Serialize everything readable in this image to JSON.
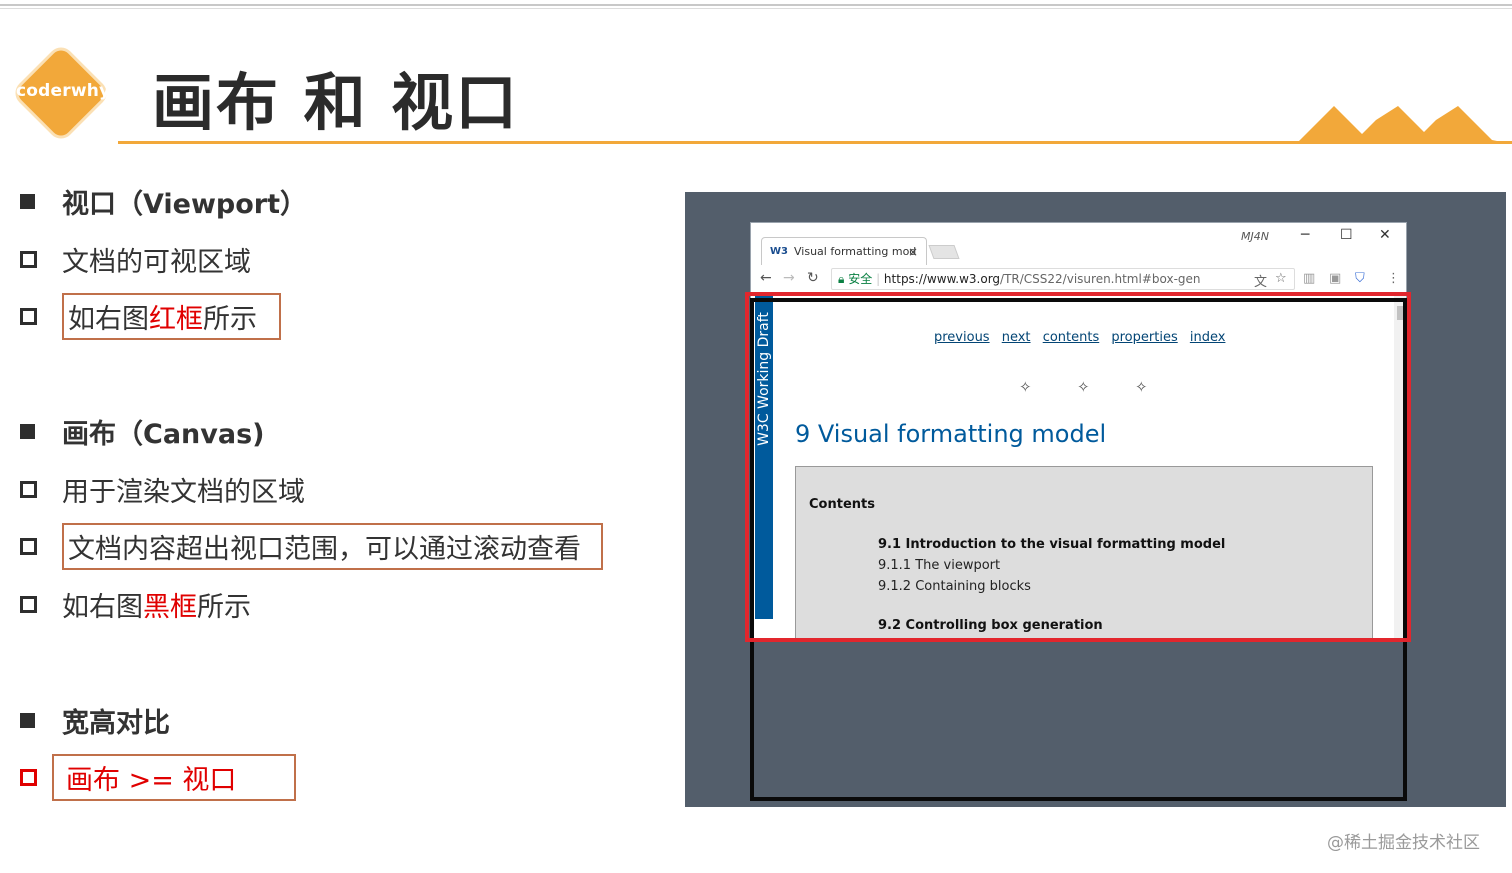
{
  "logo": {
    "text": "coderwhy"
  },
  "title": "画布 和 视口",
  "sections": [
    {
      "heading": "视口（Viewport）",
      "items": [
        {
          "segments": [
            "文档的可视区域"
          ]
        },
        {
          "segments": [
            "如右图",
            "红框",
            "所示"
          ]
        }
      ]
    },
    {
      "heading": "画布（Canvas)",
      "items": [
        {
          "segments": [
            "用于渲染文档的区域"
          ]
        },
        {
          "segments": [
            "文档内容超出视口范围，可以通过滚动查看"
          ]
        },
        {
          "segments": [
            "如右图",
            "黑框",
            "所示"
          ]
        }
      ]
    },
    {
      "heading": "宽高对比",
      "items": [
        {
          "segments": [
            "画布 >= 视口"
          ]
        }
      ]
    }
  ],
  "browser": {
    "tab_icon": "W3",
    "tab_title": "Visual formatting mod",
    "tab_close": "×",
    "window_label": "MJ4N",
    "minimize": "─",
    "maximize": "☐",
    "close": "✕",
    "secure_label": "安全",
    "url_main": "https://www.w3.org",
    "url_rest": "/TR/CSS22/visuren.html#box-gen",
    "sidebar_label": "W3C Working Draft",
    "nav_links": [
      "previous",
      "next",
      "contents",
      "properties",
      "index"
    ],
    "star_glyph": "✧",
    "heading": "9 Visual formatting model",
    "toc_title": "Contents",
    "toc": [
      {
        "text": "9.1 Introduction to the visual formatting model",
        "bold": true
      },
      {
        "text": "9.1.1 The viewport",
        "bold": false
      },
      {
        "text": "9.1.2 Containing blocks",
        "bold": false
      },
      {
        "text": "9.2 Controlling box generation",
        "bold": true
      }
    ]
  },
  "colors": {
    "accent": "#f2a83a",
    "highlight_red": "#e00000",
    "viewport_box": "#e2262d",
    "canvas_box": "#0a0a0a",
    "panel_bg": "#535e6b",
    "w3c_blue": "#005a9c"
  },
  "watermark": "@稀土掘金技术社区"
}
